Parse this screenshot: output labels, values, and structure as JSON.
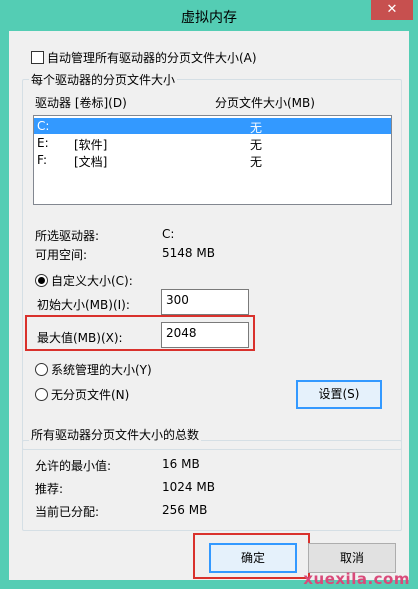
{
  "window": {
    "title": "虚拟内存",
    "close_glyph": "✕"
  },
  "auto_manage": {
    "label": "自动管理所有驱动器的分页文件大小(A)",
    "checked": false
  },
  "drives_group": {
    "legend": "每个驱动器的分页文件大小",
    "col_drive": "驱动器 [卷标](D)",
    "col_size": "分页文件大小(MB)",
    "rows": [
      {
        "drive": "C:",
        "label": "",
        "size": "无",
        "selected": true
      },
      {
        "drive": "E:",
        "label": "[软件]",
        "size": "无",
        "selected": false
      },
      {
        "drive": "F:",
        "label": "[文档]",
        "size": "无",
        "selected": false
      }
    ],
    "selected_drive_label": "所选驱动器:",
    "selected_drive_value": "C:",
    "free_space_label": "可用空间:",
    "free_space_value": "5148 MB",
    "custom_size": {
      "label": "自定义大小(C):",
      "checked": true
    },
    "initial_size_label": "初始大小(MB)(I):",
    "initial_size_value": "300",
    "max_size_label": "最大值(MB)(X):",
    "max_size_value": "2048",
    "system_managed": {
      "label": "系统管理的大小(Y)",
      "checked": false
    },
    "no_paging": {
      "label": "无分页文件(N)",
      "checked": false
    },
    "set_button": "设置(S)"
  },
  "totals_group": {
    "legend": "所有驱动器分页文件大小的总数",
    "min_label": "允许的最小值:",
    "min_value": "16 MB",
    "recommended_label": "推荐:",
    "recommended_value": "1024 MB",
    "allocated_label": "当前已分配:",
    "allocated_value": "256 MB"
  },
  "buttons": {
    "ok": "确定",
    "cancel": "取消"
  },
  "watermark": "xuexila.com",
  "colors": {
    "frame": "#54cdb4",
    "close": "#c7504f",
    "selection": "#3399ff",
    "highlight": "#d9312c"
  }
}
